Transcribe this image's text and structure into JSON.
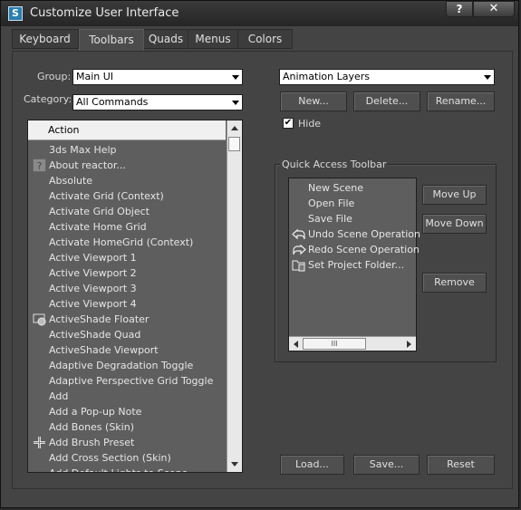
{
  "window": {
    "title": "Customize User Interface",
    "help_label": "?",
    "close_label": "✕"
  },
  "tabs": [
    {
      "label": "Keyboard"
    },
    {
      "label": "Toolbars"
    },
    {
      "label": "Quads"
    },
    {
      "label": "Menus"
    },
    {
      "label": "Colors"
    }
  ],
  "active_tab": "Toolbars",
  "left": {
    "group_label": "Group:",
    "group_value": "Main UI",
    "category_label": "Category:",
    "category_value": "All Commands",
    "list_header": "Action",
    "items": [
      {
        "label": "3ds Max Help",
        "icon": ""
      },
      {
        "label": "About reactor...",
        "icon": "question-icon"
      },
      {
        "label": "Absolute",
        "icon": ""
      },
      {
        "label": "Activate Grid (Context)",
        "icon": ""
      },
      {
        "label": "Activate Grid Object",
        "icon": ""
      },
      {
        "label": "Activate Home Grid",
        "icon": ""
      },
      {
        "label": "Activate HomeGrid (Context)",
        "icon": ""
      },
      {
        "label": "Active Viewport 1",
        "icon": ""
      },
      {
        "label": "Active Viewport 2",
        "icon": ""
      },
      {
        "label": "Active Viewport 3",
        "icon": ""
      },
      {
        "label": "Active Viewport 4",
        "icon": ""
      },
      {
        "label": "ActiveShade Floater",
        "icon": "activeshade-icon"
      },
      {
        "label": "ActiveShade Quad",
        "icon": ""
      },
      {
        "label": "ActiveShade Viewport",
        "icon": ""
      },
      {
        "label": "Adaptive Degradation Toggle",
        "icon": ""
      },
      {
        "label": "Adaptive Perspective Grid Toggle",
        "icon": ""
      },
      {
        "label": "Add",
        "icon": ""
      },
      {
        "label": "Add a Pop-up Note",
        "icon": ""
      },
      {
        "label": "Add Bones (Skin)",
        "icon": ""
      },
      {
        "label": "Add Brush Preset",
        "icon": "brush-cross-icon"
      },
      {
        "label": "Add Cross Section (Skin)",
        "icon": ""
      },
      {
        "label": "Add Default Lights to Scene",
        "icon": ""
      }
    ]
  },
  "right": {
    "toolbar_select": "Animation Layers",
    "new_label": "New...",
    "delete_label": "Delete...",
    "rename_label": "Rename...",
    "hide_label": "Hide",
    "hide_checked": true,
    "hide_check_glyph": "✔",
    "group_title": "Quick Access Toolbar",
    "qa_items": [
      {
        "label": "New Scene",
        "icon": ""
      },
      {
        "label": "Open File",
        "icon": ""
      },
      {
        "label": "Save File",
        "icon": ""
      },
      {
        "label": "Undo Scene Operation",
        "icon": "undo-icon"
      },
      {
        "label": "Redo Scene Operation",
        "icon": "redo-icon"
      },
      {
        "label": "Set Project Folder...",
        "icon": "project-folder-icon"
      }
    ],
    "move_up_label": "Move Up",
    "move_down_label": "Move Down",
    "remove_label": "Remove",
    "hscroll_grip": "III"
  },
  "bottom": {
    "load_label": "Load...",
    "save_label": "Save...",
    "reset_label": "Reset"
  }
}
